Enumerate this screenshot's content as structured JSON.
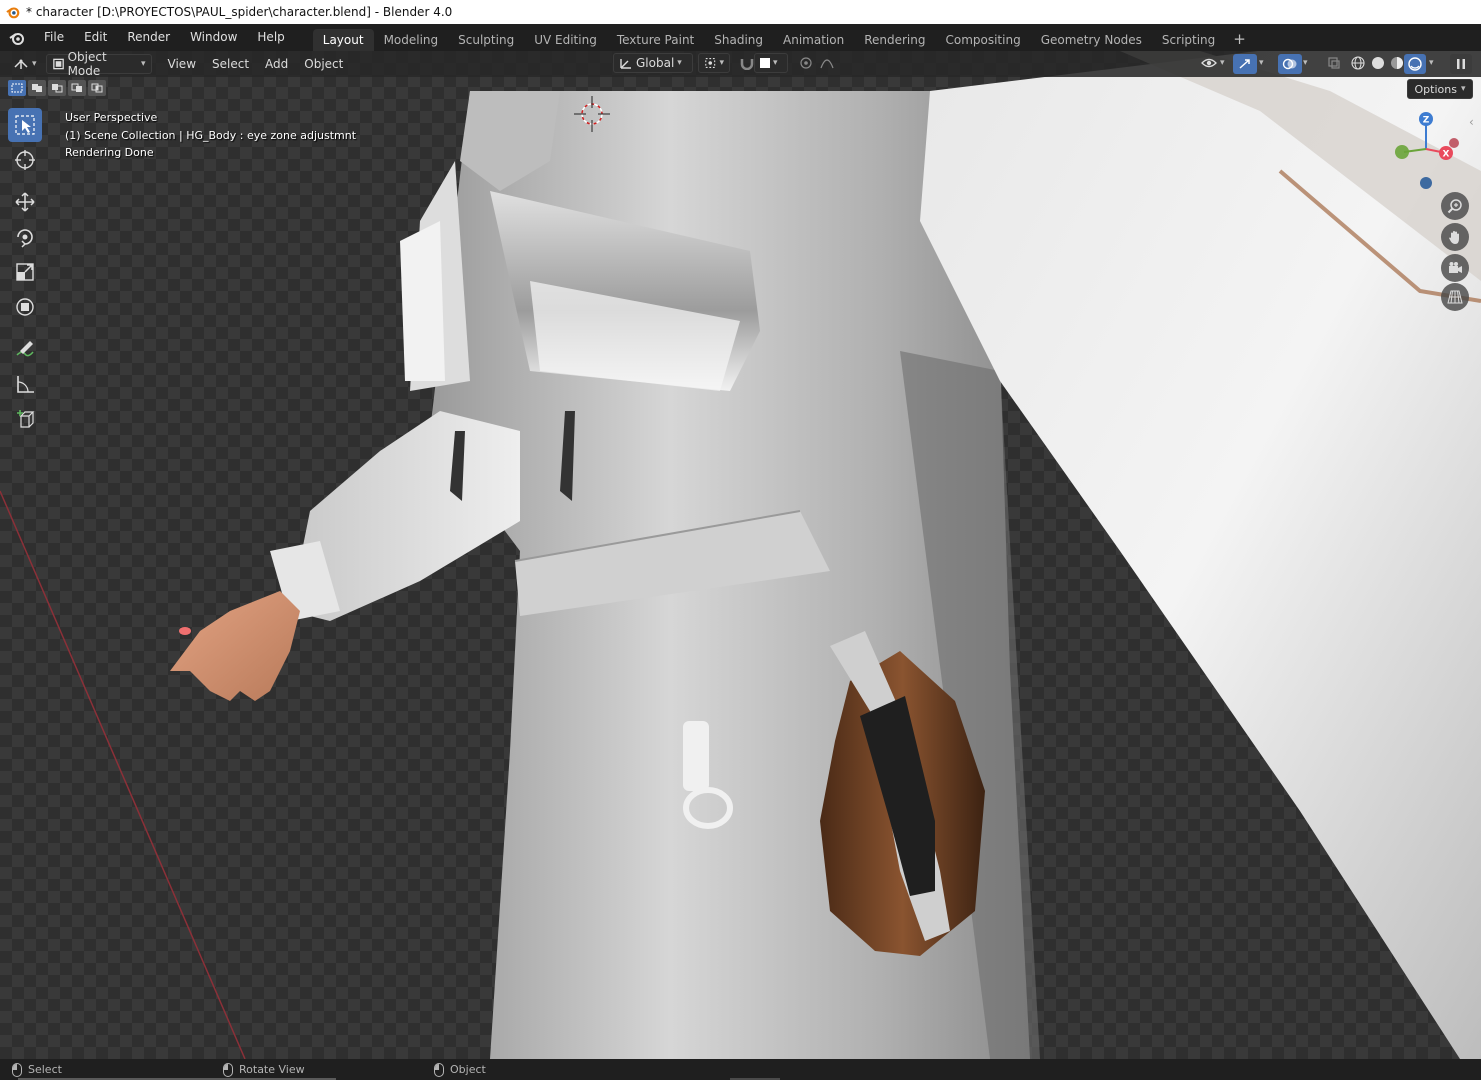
{
  "window": {
    "title": "* character [D:\\PROYECTOS\\PAUL_spider\\character.blend] - Blender 4.0"
  },
  "menubar": {
    "items": [
      "File",
      "Edit",
      "Render",
      "Window",
      "Help"
    ]
  },
  "workspaces": {
    "tabs": [
      "Layout",
      "Modeling",
      "Sculpting",
      "UV Editing",
      "Texture Paint",
      "Shading",
      "Animation",
      "Rendering",
      "Compositing",
      "Geometry Nodes",
      "Scripting"
    ],
    "active": "Layout",
    "add_label": "+"
  },
  "viewport_header": {
    "mode": "Object Mode",
    "menus": [
      "View",
      "Select",
      "Add",
      "Object"
    ],
    "transform_orientation": "Global"
  },
  "overlay": {
    "line1": "User Perspective",
    "line2": "(1) Scene Collection | HG_Body : eye zone adjustmnt",
    "line3": "Rendering Done"
  },
  "options_label": "Options",
  "gizmo": {
    "z": "Z",
    "x": "X"
  },
  "statusbar": {
    "select": "Select",
    "rotate": "Rotate View",
    "object": "Object"
  },
  "colors": {
    "accent": "#4772b3",
    "axis_x": "#e94a5c",
    "axis_y": "#6aa43a",
    "axis_z": "#3d7cd1"
  }
}
